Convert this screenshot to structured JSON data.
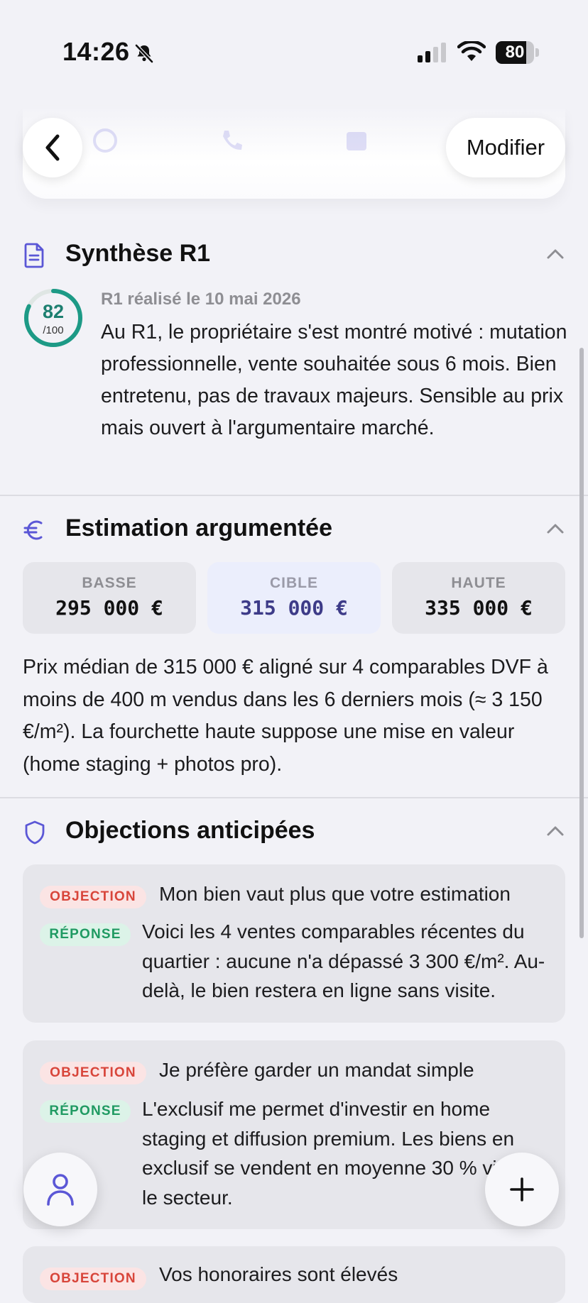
{
  "status_bar": {
    "time": "14:26",
    "battery": "80",
    "battery_level": 0.8
  },
  "nav": {
    "modify_label": "Modifier"
  },
  "synthese": {
    "title": "Synthèse R1",
    "score": "82",
    "score_max": "/100",
    "score_value": 82,
    "date": "R1 réalisé le 10 mai 2026",
    "text": "Au R1, le propriétaire s'est montré motivé : mutation professionnelle, vente souhaitée sous 6 mois. Bien entretenu, pas de travaux majeurs. Sensible au prix mais ouvert à l'argumentaire marché."
  },
  "estimation": {
    "title": "Estimation argumentée",
    "cards": [
      {
        "label": "BASSE",
        "value": "295 000 €"
      },
      {
        "label": "CIBLE",
        "value": "315 000 €"
      },
      {
        "label": "HAUTE",
        "value": "335 000 €"
      }
    ],
    "text": "Prix médian de 315 000 € aligné sur 4 comparables DVF à moins de 400 m vendus dans les 6 derniers mois (≈ 3 150 €/m²). La fourchette haute suppose une mise en valeur (home staging + photos pro)."
  },
  "objections": {
    "title": "Objections anticipées",
    "objection_badge": "OBJECTION",
    "response_badge": "RÉPONSE",
    "items": [
      {
        "objection": "Mon bien vaut plus que votre estimation",
        "response": "Voici les 4 ventes comparables récentes du quartier : aucune n'a dépassé 3 300 €/m². Au-delà, le bien restera en ligne sans visite."
      },
      {
        "objection": "Je préfère garder un mandat simple",
        "response": "L'exclusif me permet d'investir en home staging et diffusion premium. Les biens en exclusif se vendent en moyenne 30 % vite sur le secteur."
      },
      {
        "objection": "Vos honoraires sont élevés",
        "response": ""
      }
    ]
  },
  "colors": {
    "accent": "#5b57d6",
    "score_ring": "#1d9a86",
    "objection": "#d8453a",
    "response": "#1f9a62"
  }
}
